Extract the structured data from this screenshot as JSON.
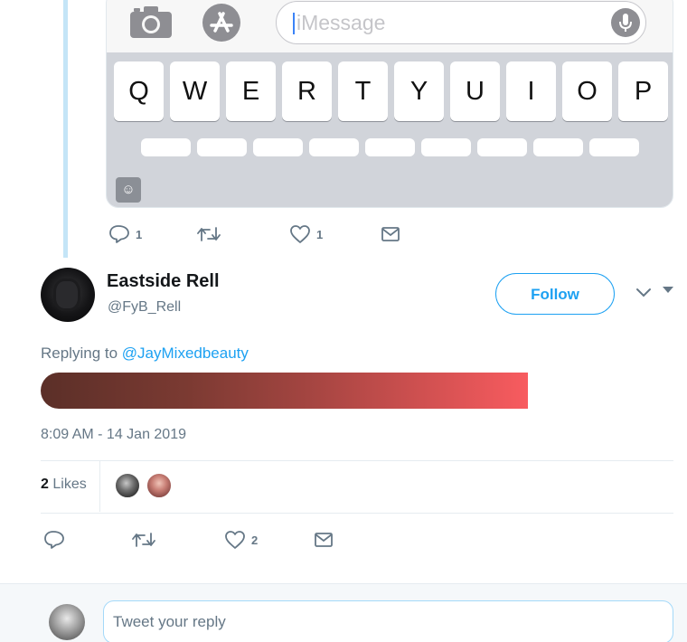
{
  "embedded_screenshot": {
    "message_placeholder": "iMessage",
    "keyboard_row": [
      "Q",
      "W",
      "E",
      "R",
      "T",
      "Y",
      "U",
      "I",
      "O",
      "P"
    ],
    "emoji_key": "☺"
  },
  "parent_tweet_actions": {
    "reply_count": "1",
    "retweet_count": "",
    "like_count": "1"
  },
  "tweet": {
    "display_name": "Eastside Rell",
    "handle": "@FyB_Rell",
    "follow_label": "Follow",
    "replying_prefix": "Replying to",
    "replying_handle": "@JayMixedbeauty",
    "timestamp": "8:09 AM - 14 Jan 2019",
    "likes_number": "2",
    "likes_label": "Likes",
    "actions": {
      "reply_count": "",
      "retweet_count": "",
      "like_count": "2"
    }
  },
  "reply_box": {
    "placeholder": "Tweet your reply"
  },
  "colors": {
    "accent": "#1da1f2",
    "muted": "#657786",
    "thread_line": "#c4e5f7",
    "bar_start": "#5b2f28",
    "bar_end": "#f85b5f"
  },
  "icons": {
    "camera": "camera-icon",
    "app_store": "app-store-icon",
    "microphone": "microphone-icon",
    "reply": "reply-icon",
    "retweet": "retweet-icon",
    "like": "heart-icon",
    "dm": "envelope-icon",
    "more": "chevron-down-icon"
  }
}
